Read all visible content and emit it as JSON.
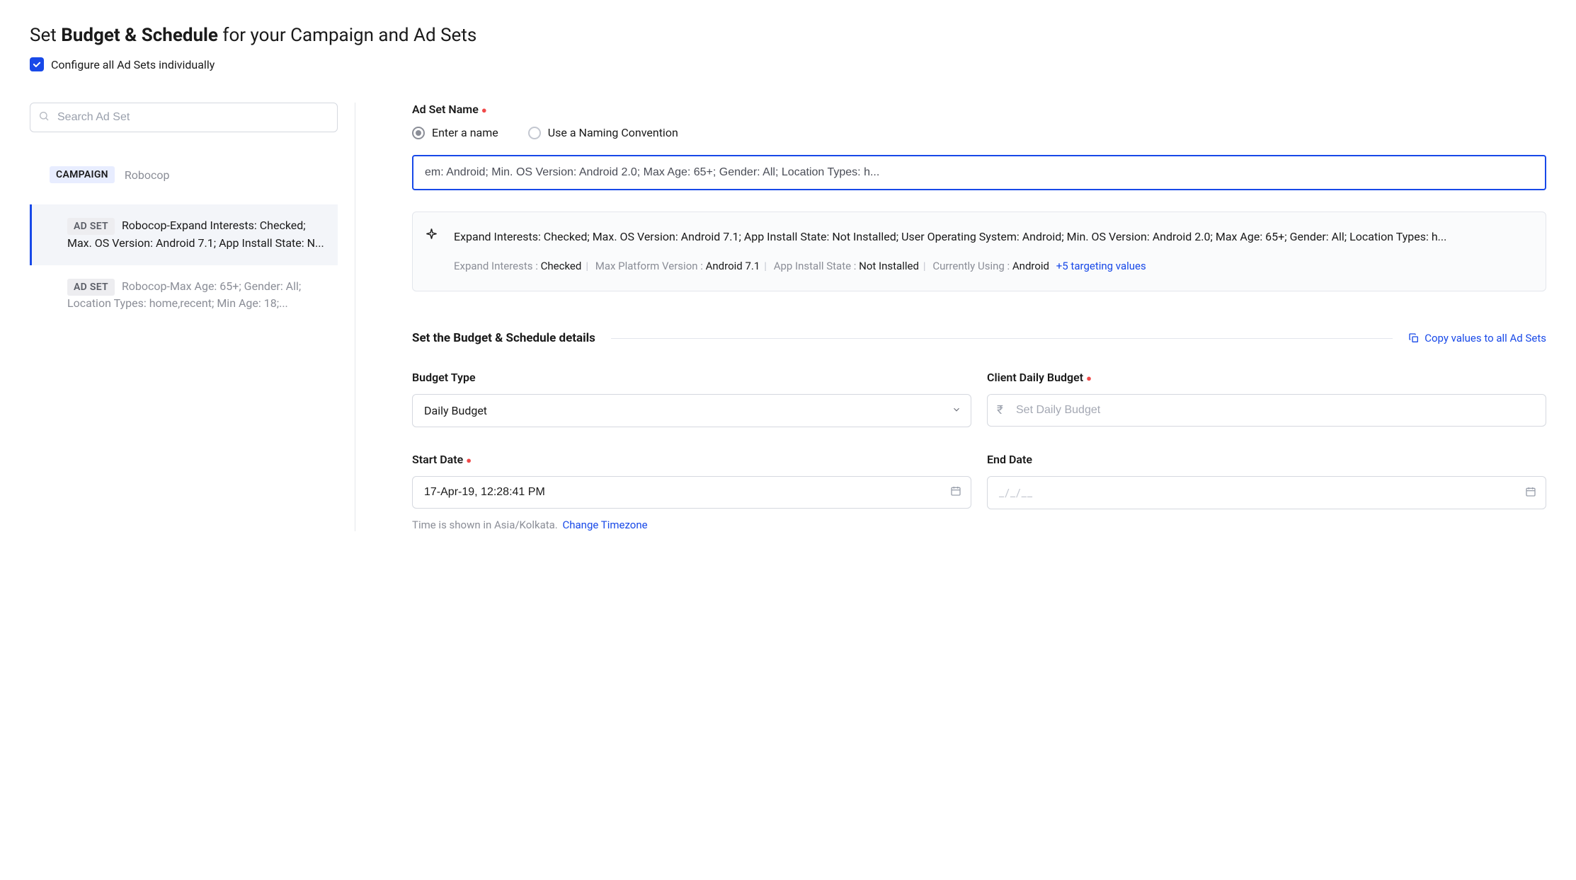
{
  "title": {
    "pre": "Set ",
    "bold": "Budget & Schedule",
    "post": " for your Campaign and Ad Sets"
  },
  "config_all_label": "Configure all Ad Sets individually",
  "search": {
    "placeholder": "Search Ad Set"
  },
  "campaign": {
    "tag": "CAMPAIGN",
    "name": "Robocop"
  },
  "adset_tag": "AD SET",
  "adsets": [
    {
      "text": "Robocop-Expand Interests: Checked; Max. OS Version: Android 7.1; App Install State: N..."
    },
    {
      "text": "Robocop-Max Age: 65+; Gender: All; Location Types: home,recent; Min Age: 18;..."
    }
  ],
  "adset_name": {
    "label": "Ad Set Name",
    "radio_enter": "Enter a name",
    "radio_convention": "Use a Naming Convention",
    "value": "em: Android; Min. OS Version: Android 2.0; Max Age: 65+; Gender: All; Location Types: h..."
  },
  "targeting": {
    "summary": "Expand Interests: Checked; Max. OS Version: Android 7.1; App Install State: Not Installed; User Operating System: Android; Min. OS Version: Android 2.0; Max Age: 65+; Gender: All; Location Types: h...",
    "kv": [
      {
        "label": "Expand Interests : ",
        "value": "Checked"
      },
      {
        "label": "Max Platform Version : ",
        "value": "Android 7.1"
      },
      {
        "label": "App Install State : ",
        "value": "Not Installed"
      },
      {
        "label": "Currently Using : ",
        "value": "Android"
      }
    ],
    "more": "+5 targeting values"
  },
  "budget_section": {
    "title": "Set the Budget & Schedule details",
    "copy_link": "Copy values to all Ad Sets"
  },
  "fields": {
    "budget_type": {
      "label": "Budget Type",
      "value": "Daily Budget"
    },
    "client_budget": {
      "label": "Client Daily Budget",
      "placeholder": "Set Daily Budget",
      "currency": "₹"
    },
    "start_date": {
      "label": "Start Date",
      "value": "17-Apr-19, 12:28:41 PM"
    },
    "end_date": {
      "label": "End Date",
      "placeholder": "_/_/__"
    }
  },
  "timezone": {
    "text": "Time is shown in Asia/Kolkata.",
    "link": "Change Timezone"
  }
}
